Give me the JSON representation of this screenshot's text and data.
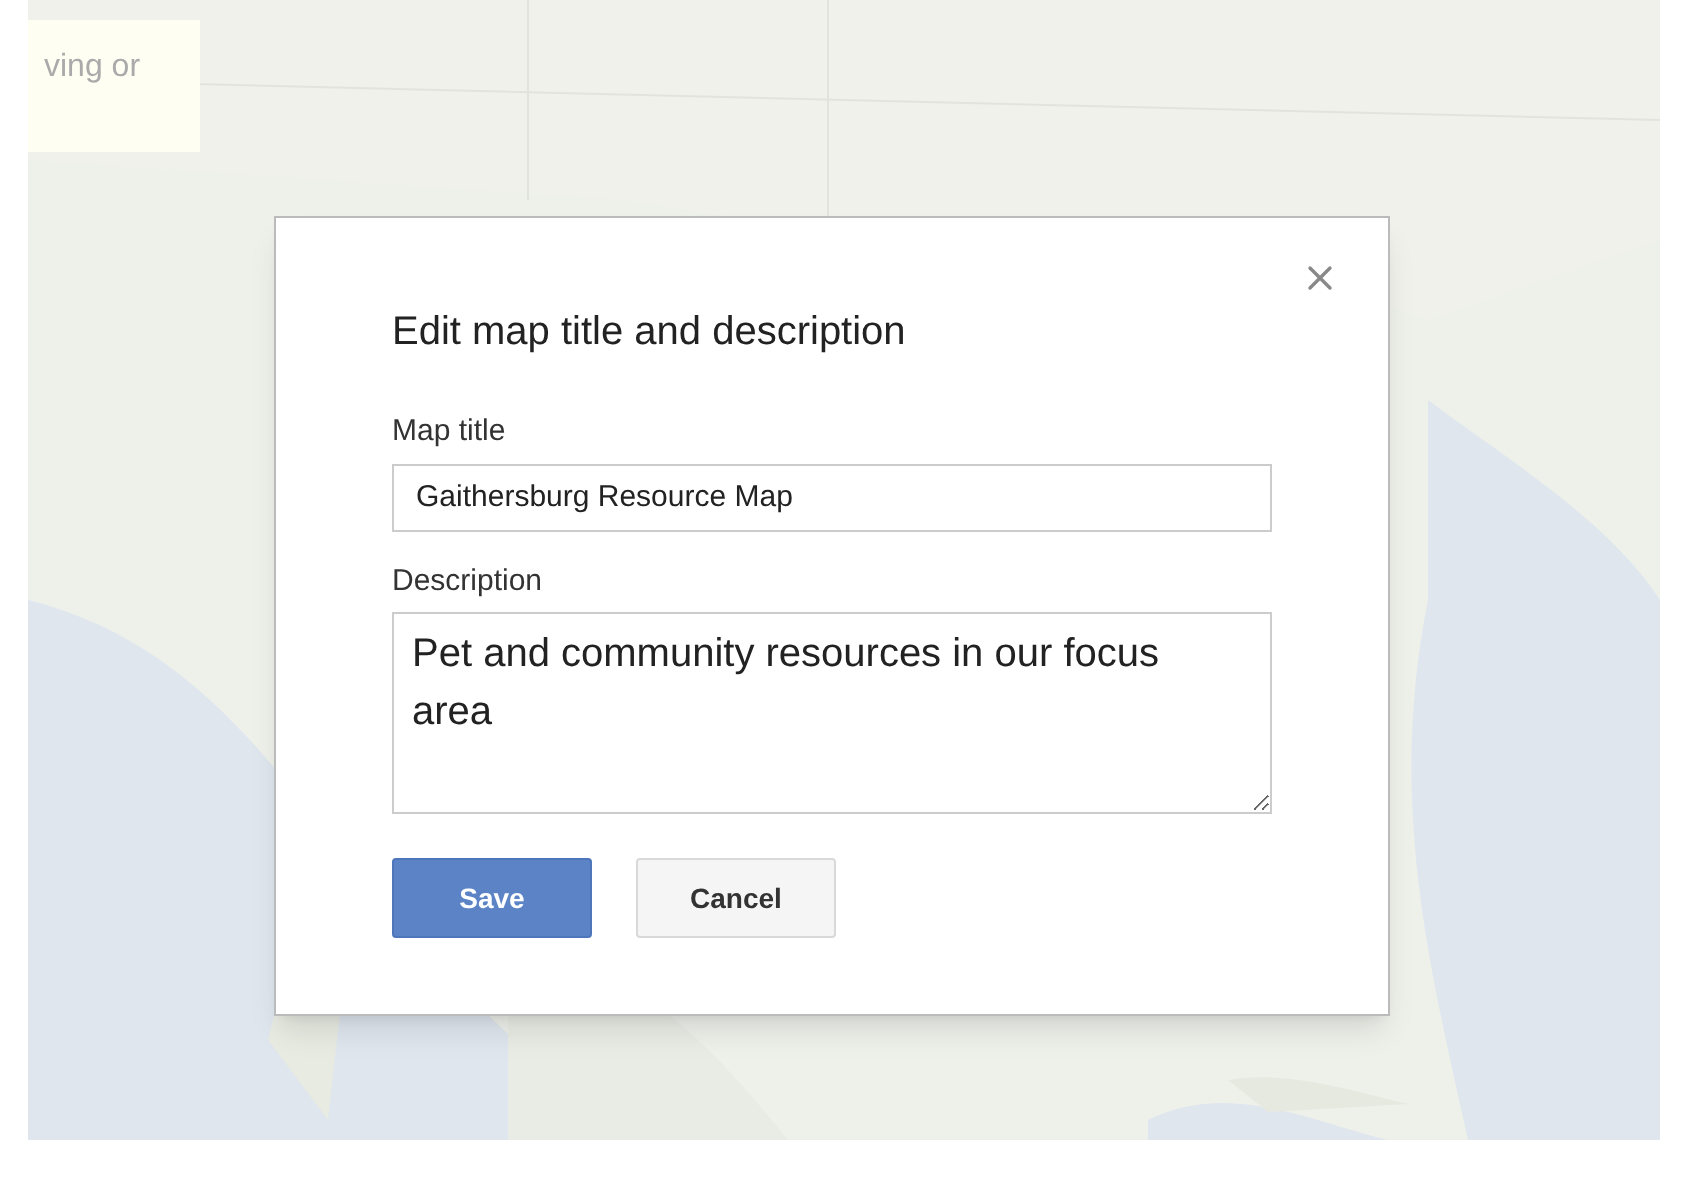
{
  "side_panel": {
    "text": "ving or"
  },
  "dialog": {
    "title": "Edit map title and description",
    "fields": [
      {
        "kind": "input",
        "label": "Map title",
        "value": "Gaithersburg Resource Map"
      },
      {
        "kind": "textarea",
        "label": "Description",
        "value": "Pet and community resources in our focus area"
      }
    ],
    "buttons": [
      {
        "label": "Save",
        "kind": "primary"
      },
      {
        "label": "Cancel",
        "kind": "secondary"
      }
    ]
  }
}
